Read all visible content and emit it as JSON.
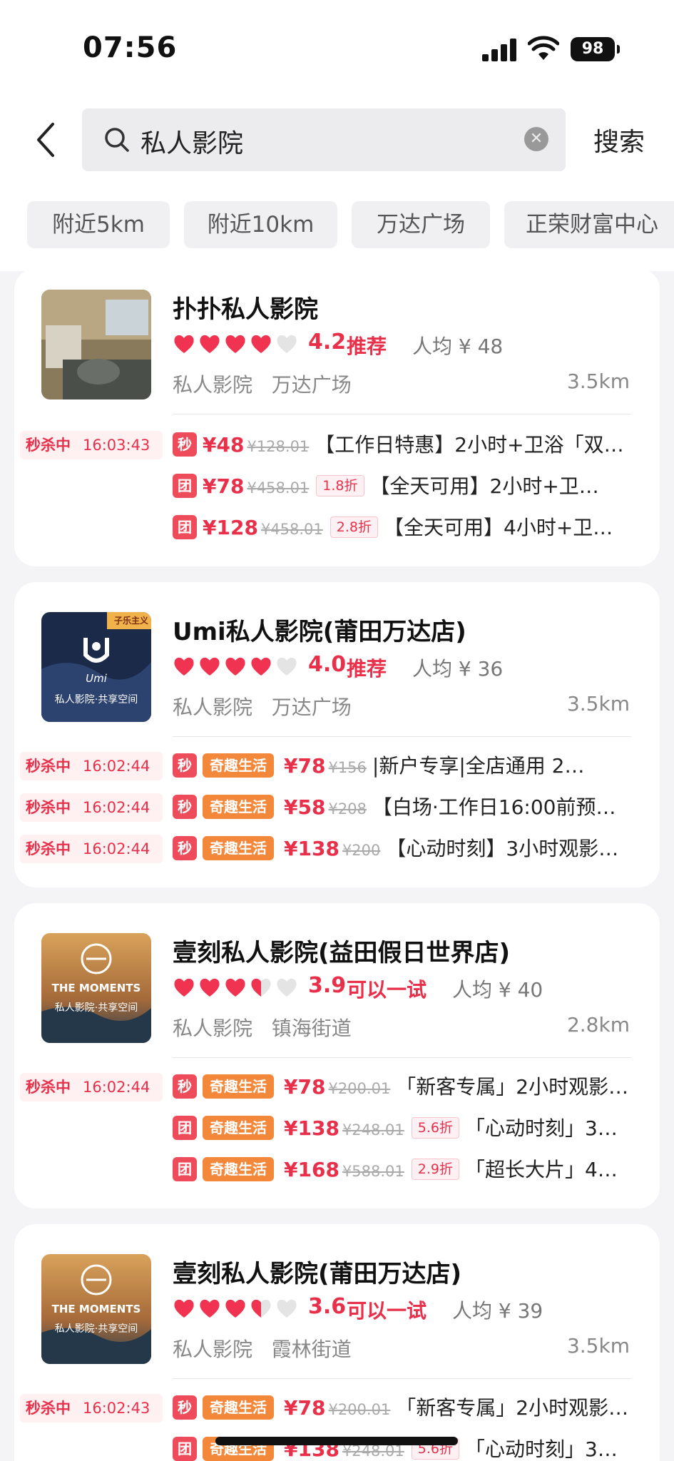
{
  "status": {
    "time": "07:56",
    "battery": "98"
  },
  "search": {
    "query": "私人影院",
    "button": "搜索"
  },
  "chips": [
    "附近5km",
    "附近10km",
    "万达广场",
    "正荣财富中心"
  ],
  "colors": {
    "accent": "#e8304a",
    "brand_orange": "#f3873a"
  },
  "stores": [
    {
      "name": "扑扑私人影院",
      "rating": "4.2",
      "rating_fraction": 0.84,
      "tag": "推荐",
      "avg": "人均 ¥ 48",
      "category": "私人影院",
      "area": "万达广场",
      "distance": "3.5km",
      "deals": [
        {
          "flash": "秒杀中",
          "timer": "16:03:43",
          "badge": "秒",
          "brand": "",
          "price": "¥48",
          "orig": "¥128.01",
          "disc": "",
          "text": "【工作日特惠】2小时+卫浴「双…"
        },
        {
          "flash": "",
          "timer": "",
          "badge": "团",
          "brand": "",
          "price": "¥78",
          "orig": "¥458.01",
          "disc": "1.8折",
          "text": "【全天可用】2小时+卫…"
        },
        {
          "flash": "",
          "timer": "",
          "badge": "团",
          "brand": "",
          "price": "¥128",
          "orig": "¥458.01",
          "disc": "2.8折",
          "text": "【全天可用】4小时+卫…"
        }
      ]
    },
    {
      "name": "Umi私人影院(莆田万达店)",
      "rating": "4.0",
      "rating_fraction": 0.8,
      "tag": "推荐",
      "avg": "人均 ¥ 36",
      "category": "私人影院",
      "area": "万达广场",
      "distance": "3.5km",
      "deals": [
        {
          "flash": "秒杀中",
          "timer": "16:02:44",
          "badge": "秒",
          "brand": "奇趣生活",
          "price": "¥78",
          "orig": "¥156",
          "disc": "",
          "text": "|新户专享|全店通用 2…"
        },
        {
          "flash": "秒杀中",
          "timer": "16:02:44",
          "badge": "秒",
          "brand": "奇趣生活",
          "price": "¥58",
          "orig": "¥208",
          "disc": "",
          "text": "【白场·工作日16:00前预…"
        },
        {
          "flash": "秒杀中",
          "timer": "16:02:44",
          "badge": "秒",
          "brand": "奇趣生活",
          "price": "¥138",
          "orig": "¥200",
          "disc": "",
          "text": "【心动时刻】3小时观影…"
        }
      ]
    },
    {
      "name": "壹刻私人影院(益田假日世界店)",
      "rating": "3.9",
      "rating_fraction": 0.78,
      "tag": "可以一试",
      "avg": "人均 ¥ 40",
      "category": "私人影院",
      "area": "镇海街道",
      "distance": "2.8km",
      "deals": [
        {
          "flash": "秒杀中",
          "timer": "16:02:44",
          "badge": "秒",
          "brand": "奇趣生活",
          "price": "¥78",
          "orig": "¥200.01",
          "disc": "",
          "text": "「新客专属」2小时观影…"
        },
        {
          "flash": "",
          "timer": "",
          "badge": "团",
          "brand": "奇趣生活",
          "price": "¥138",
          "orig": "¥248.01",
          "disc": "5.6折",
          "text": "「心动时刻」3…"
        },
        {
          "flash": "",
          "timer": "",
          "badge": "团",
          "brand": "奇趣生活",
          "price": "¥168",
          "orig": "¥588.01",
          "disc": "2.9折",
          "text": "「超长大片」4…"
        }
      ]
    },
    {
      "name": "壹刻私人影院(莆田万达店)",
      "rating": "3.6",
      "rating_fraction": 0.72,
      "tag": "可以一试",
      "avg": "人均 ¥ 39",
      "category": "私人影院",
      "area": "霞林街道",
      "distance": "3.5km",
      "deals": [
        {
          "flash": "秒杀中",
          "timer": "16:02:43",
          "badge": "秒",
          "brand": "奇趣生活",
          "price": "¥78",
          "orig": "¥200.01",
          "disc": "",
          "text": "「新客专属」2小时观影…"
        },
        {
          "flash": "",
          "timer": "",
          "badge": "团",
          "brand": "奇趣生活",
          "price": "¥138",
          "orig": "¥248.01",
          "disc": "5.6折",
          "text": "「心动时刻」3…"
        }
      ]
    }
  ],
  "thumbs": [
    {
      "caption": ""
    },
    {
      "caption": "私人影院·共享空间",
      "logo": "Umi",
      "corner": "子乐主义"
    },
    {
      "caption": "私人影院·共享空间",
      "logo": "THE MOMENTS"
    },
    {
      "caption": "私人影院·共享空间",
      "logo": "THE MOMENTS"
    }
  ]
}
